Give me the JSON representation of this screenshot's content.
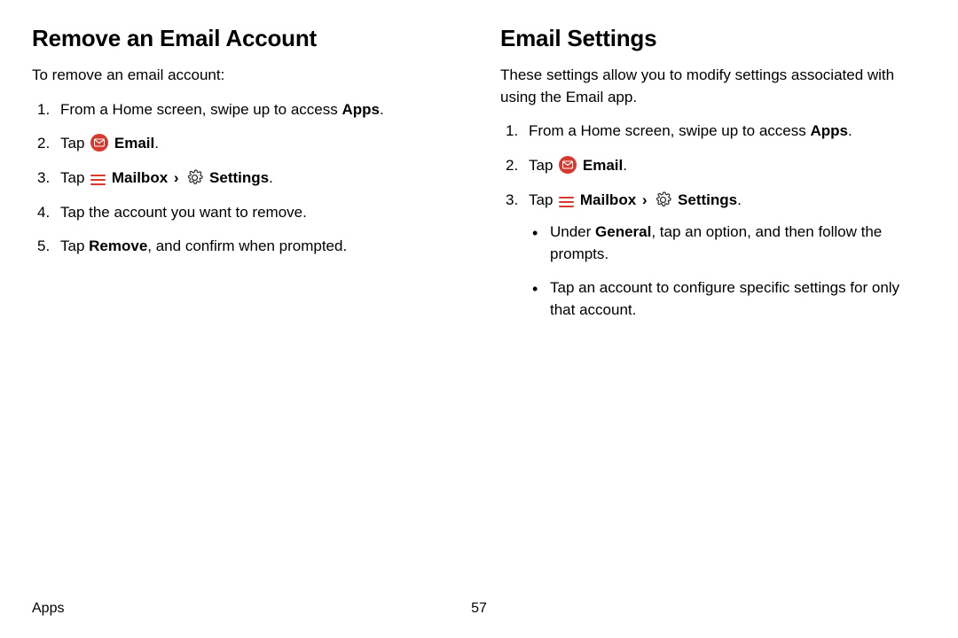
{
  "left": {
    "heading": "Remove an Email Account",
    "intro": "To remove an email account:",
    "steps": {
      "s1_a": "From a Home screen, swipe up to access ",
      "s1_b": "Apps",
      "s1_c": ".",
      "s2_a": "Tap ",
      "s2_b": "Email",
      "s2_c": ".",
      "s3_a": "Tap ",
      "s3_b": "Mailbox",
      "s3_chev": "›",
      "s3_c": "Settings",
      "s3_d": ".",
      "s4": "Tap the account you want to remove.",
      "s5_a": "Tap ",
      "s5_b": "Remove",
      "s5_c": ", and confirm when prompted."
    }
  },
  "right": {
    "heading": "Email Settings",
    "intro": "These settings allow you to modify settings associated with using the Email app.",
    "steps": {
      "s1_a": "From a Home screen, swipe up to access ",
      "s1_b": "Apps",
      "s1_c": ".",
      "s2_a": "Tap ",
      "s2_b": "Email",
      "s2_c": ".",
      "s3_a": "Tap ",
      "s3_b": "Mailbox",
      "s3_chev": "›",
      "s3_c": "Settings",
      "s3_d": "."
    },
    "bullets": {
      "b1_a": "Under ",
      "b1_b": "General",
      "b1_c": ", tap an option, and then follow the prompts.",
      "b2": "Tap an account to configure specific settings for only that account."
    }
  },
  "footer": {
    "section": "Apps",
    "page": "57"
  }
}
